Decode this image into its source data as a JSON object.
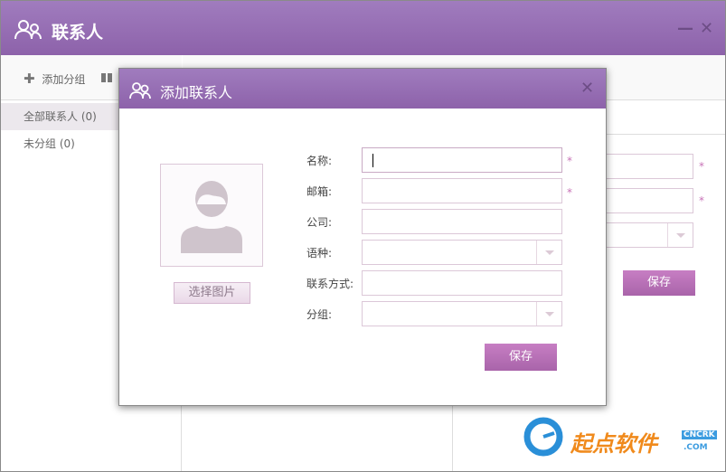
{
  "window": {
    "title": "联系人",
    "icon": "contacts-icon",
    "minimize_icon": "minimize-icon",
    "close_icon": "close-icon"
  },
  "sidebar": {
    "add_group": "添加分组",
    "groups": [
      {
        "label": "全部联系人 (0)"
      },
      {
        "label": "未分组 (0)"
      }
    ]
  },
  "background_form": {
    "save": "保存"
  },
  "dialog": {
    "title": "添加联系人",
    "choose_image": "选择图片",
    "fields": [
      {
        "label": "名称:",
        "value": "",
        "required": true,
        "type": "text"
      },
      {
        "label": "邮箱:",
        "value": "",
        "required": true,
        "type": "text"
      },
      {
        "label": "公司:",
        "value": "",
        "type": "text"
      },
      {
        "label": "语种:",
        "value": "",
        "type": "select"
      },
      {
        "label": "联系方式:",
        "value": "",
        "type": "text"
      },
      {
        "label": "分组:",
        "value": "",
        "type": "select"
      }
    ],
    "required_mark": "*",
    "save": "保存"
  },
  "watermark": {
    "text": "起点软件",
    "badge": "CNCRK",
    ".com": ".COM"
  },
  "colors": {
    "accent": "#9670b4",
    "button": "#b86cb6"
  }
}
